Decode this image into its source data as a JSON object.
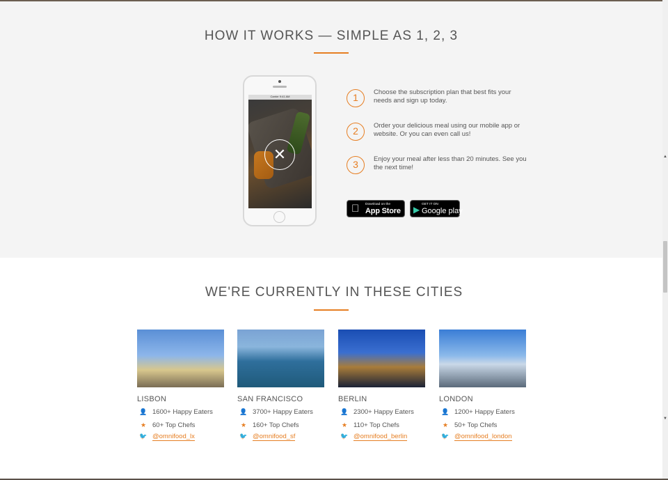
{
  "how_it_works": {
    "title": "How it works — Simple as 1, 2, 3",
    "phone": {
      "status_left": "Carrier",
      "status_time": "9:41 AM"
    },
    "steps": [
      {
        "number": "1",
        "text": "Choose the subscription plan that best fits your needs and sign up today."
      },
      {
        "number": "2",
        "text": "Order your delicious meal using our mobile app or website. Or you can even call us!"
      },
      {
        "number": "3",
        "text": "Enjoy your meal after less than 20 minutes. See you the next time!"
      }
    ],
    "app_store": {
      "small": "Download on the",
      "big": "App Store",
      "icon": "apple-icon"
    },
    "google_play": {
      "small": "GET IT ON",
      "big": "Google play",
      "icon": "play-icon"
    }
  },
  "cities": {
    "title": "We're currently in these cities",
    "items": [
      {
        "name": "Lisbon",
        "eaters": "1600+ Happy Eaters",
        "chefs": "60+ Top Chefs",
        "twitter": "@omnifood_lx"
      },
      {
        "name": "San Francisco",
        "eaters": "3700+ Happy Eaters",
        "chefs": "160+ Top Chefs",
        "twitter": "@omnifood_sf"
      },
      {
        "name": "Berlin",
        "eaters": "2300+ Happy Eaters",
        "chefs": "110+ Top Chefs",
        "twitter": "@omnifood_berlin"
      },
      {
        "name": "London",
        "eaters": "1200+ Happy Eaters",
        "chefs": "50+ Top Chefs",
        "twitter": "@omnifood_london"
      }
    ],
    "icons": {
      "eaters": "person-icon",
      "chefs": "star-icon",
      "twitter": "twitter-icon"
    }
  },
  "colors": {
    "accent": "#e67e22",
    "section_bg": "#f4f4f4",
    "text": "#555555"
  }
}
